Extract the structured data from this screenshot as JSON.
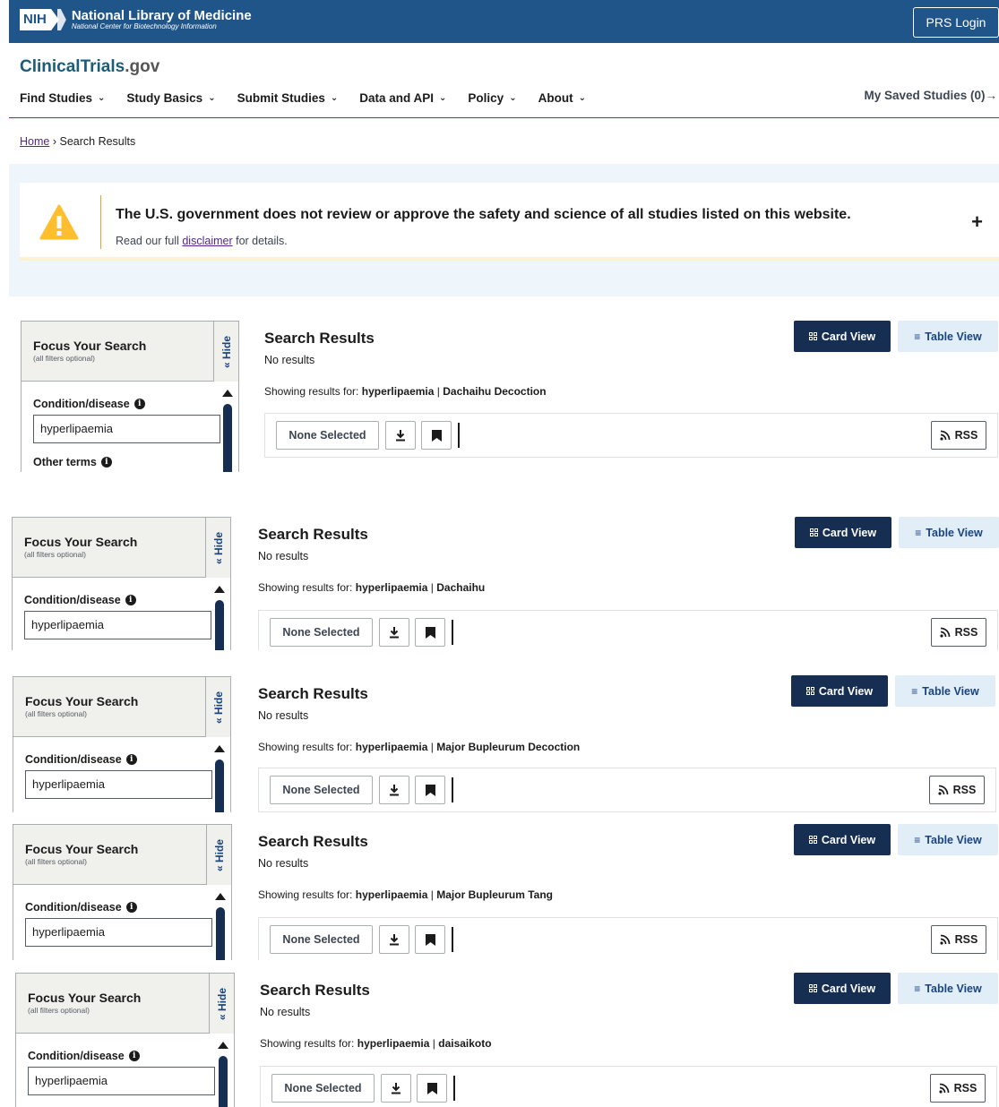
{
  "header": {
    "nih_badge": "NIH",
    "nih_title": "National Library of Medicine",
    "nih_subtitle": "National Center for Biotechnology Information",
    "prs_login": "PRS Login",
    "site_name": "ClinicalTrials",
    "site_suffix": ".gov",
    "nav": [
      {
        "label": "Find Studies"
      },
      {
        "label": "Study Basics"
      },
      {
        "label": "Submit Studies"
      },
      {
        "label": "Data and API"
      },
      {
        "label": "Policy"
      },
      {
        "label": "About"
      }
    ],
    "saved_studies": "My Saved Studies (0)→"
  },
  "breadcrumb": {
    "home": "Home",
    "sep": "›",
    "current": "Search Results"
  },
  "disclaimer": {
    "heading": "The U.S. government does not review or approve the safety and science of all studies listed on this website.",
    "pre": "Read our full ",
    "link": "disclaimer",
    "post": " for details.",
    "toggle": "+"
  },
  "colors": {
    "nih_blue": "#20558a",
    "navy": "#162e51",
    "link_purple": "#54278f",
    "warning": "#ffbe2e"
  },
  "common": {
    "focus_title": "Focus Your Search",
    "focus_note": "(all filters optional)",
    "hide": "« Hide",
    "condition_label": "Condition/disease",
    "condition_value": "hyperlipaemia",
    "other_terms": "Other terms",
    "results_title": "Search Results",
    "no_results": "No results",
    "showing_label": "Showing results for:",
    "card_view": "Card View",
    "table_view": "Table View",
    "none_selected": "None Selected",
    "rss": "RSS",
    "icons": [
      "info-icon",
      "download-icon",
      "bookmark-icon",
      "rss-icon",
      "grid-icon",
      "list-icon",
      "warning-icon"
    ]
  },
  "panels": [
    {
      "condition": "hyperlipaemia",
      "intervention": "Dachaihu Decoction"
    },
    {
      "condition": "hyperlipaemia",
      "intervention": "Dachaihu"
    },
    {
      "condition": "hyperlipaemia",
      "intervention": "Major Bupleurum Decoction"
    },
    {
      "condition": "hyperlipaemia",
      "intervention": "Major Bupleurum Tang"
    },
    {
      "condition": "hyperlipaemia",
      "intervention": "daisaikoto"
    }
  ]
}
